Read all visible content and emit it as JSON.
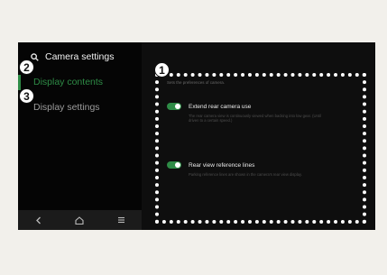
{
  "header": {
    "title": "Camera settings",
    "search_icon": "search-icon"
  },
  "sidebar": {
    "items": [
      {
        "label": "Display contents",
        "active": true
      },
      {
        "label": "Display settings",
        "active": false
      }
    ]
  },
  "navbar": {
    "icons": [
      "back-icon",
      "home-icon",
      "menu-icon"
    ]
  },
  "content": {
    "subheading": "Sets the preferences of camera.",
    "options": [
      {
        "title": "Extend rear camera use",
        "description": "The rear camera view is continuously viewed when backing into low gear. (Until driven to a certain speed.)",
        "enabled": true
      },
      {
        "title": "Rear view reference lines",
        "description": "Parking reference lines are shown in the camera's rear view display.",
        "enabled": true
      }
    ]
  },
  "callouts": [
    "1",
    "2",
    "3"
  ],
  "colors": {
    "accent": "#2e8b46",
    "background": "#050505",
    "panel": "#0e0e0e",
    "highlight_border": "#ffffff"
  }
}
